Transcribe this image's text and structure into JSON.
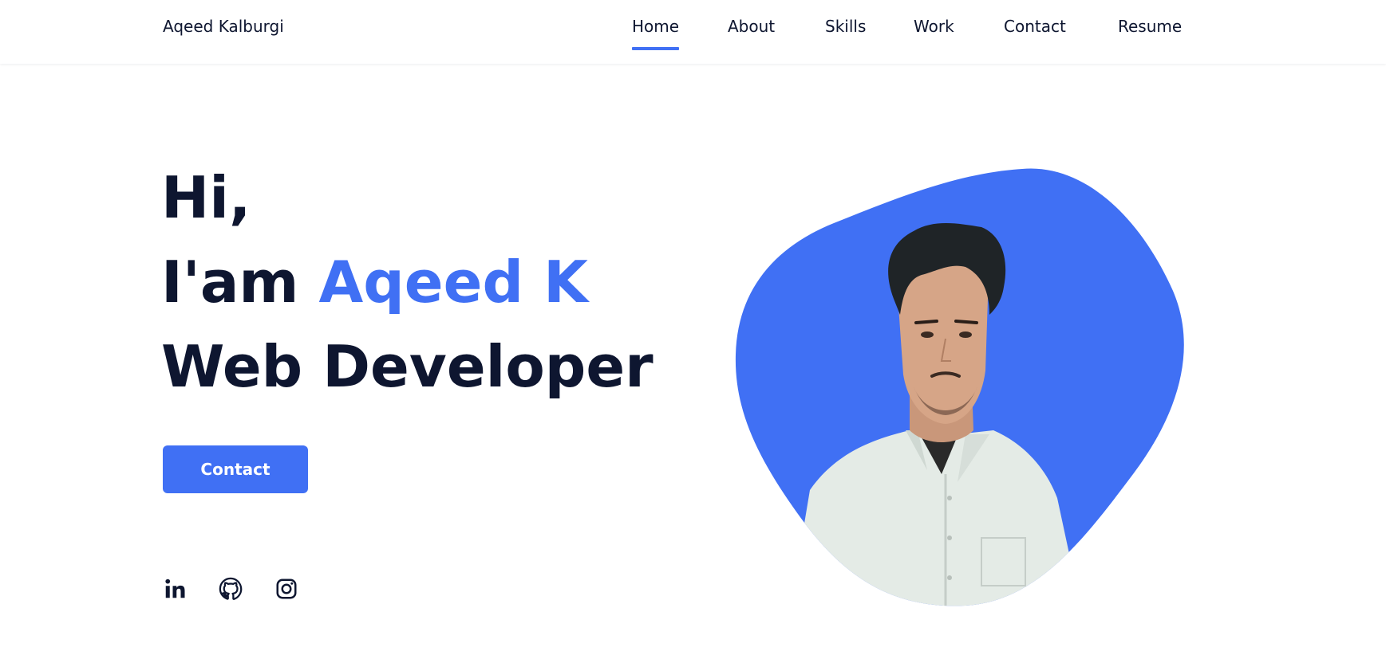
{
  "header": {
    "logo": "Aqeed Kalburgi",
    "nav": [
      {
        "label": "Home",
        "active": true
      },
      {
        "label": "About",
        "active": false
      },
      {
        "label": "Skills",
        "active": false
      },
      {
        "label": "Work",
        "active": false
      },
      {
        "label": "Contact",
        "active": false
      },
      {
        "label": "Resume",
        "active": false
      }
    ]
  },
  "hero": {
    "greeting": "Hi,",
    "intro_prefix": "I'am",
    "name": "Aqeed K",
    "role": "Web Developer",
    "contact_button": "Contact"
  },
  "social": [
    {
      "icon": "linkedin-icon"
    },
    {
      "icon": "github-icon"
    },
    {
      "icon": "instagram-icon"
    }
  ],
  "colors": {
    "accent": "#4070f4",
    "text": "#0e1630",
    "background": "#ffffff"
  }
}
